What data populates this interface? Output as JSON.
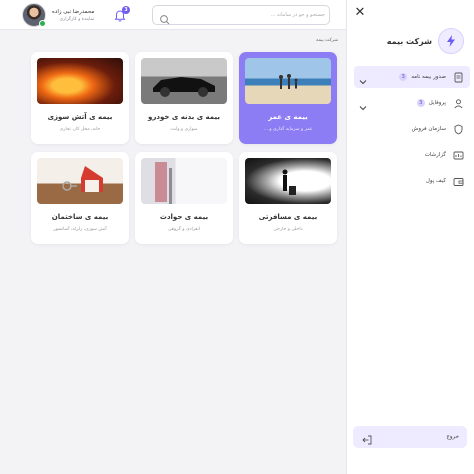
{
  "user": {
    "name": "محمدرضا نبی زاده",
    "role": "نماینده و کارگزاری"
  },
  "notifications": {
    "count": "3"
  },
  "search": {
    "placeholder": "جستجو و جو در سامانه ..."
  },
  "sidebar": {
    "company": "شرکت بیمه",
    "items": [
      {
        "label": "صدور بیمه نامه",
        "badge": "3",
        "icon": "policy-issue-icon",
        "expandable": true,
        "active": true
      },
      {
        "label": "پروفایل",
        "badge": "3",
        "icon": "user-icon",
        "expandable": true,
        "active": false
      },
      {
        "label": "سازمان فروش",
        "badge": "",
        "icon": "shield-icon",
        "expandable": false,
        "active": false
      },
      {
        "label": "گزارشات",
        "badge": "",
        "icon": "report-icon",
        "expandable": false,
        "active": false
      },
      {
        "label": "کیف پول",
        "badge": "",
        "icon": "wallet-icon",
        "expandable": false,
        "active": false
      }
    ],
    "logout_label": "خروج"
  },
  "main": {
    "section_title": "شرکت بیمه",
    "cards": [
      {
        "title": "بیمه ی عمر",
        "subtitle": "عمر و سرمایه گذاری و ...",
        "image": "life-image",
        "active": true
      },
      {
        "title": "بیمه ی بدنه ی خودرو",
        "subtitle": "سواری و وانت",
        "image": "car-image",
        "active": false
      },
      {
        "title": "بیمه ی آتش سوزی",
        "subtitle": "خانه، محل کار، تجاری",
        "image": "fire-image",
        "active": false
      },
      {
        "title": "بیمه ی مسافرتی",
        "subtitle": "داخلی و خارجی",
        "image": "travel-image",
        "active": false
      },
      {
        "title": "بیمه ی حوادث",
        "subtitle": "انفرادی و گروهی",
        "image": "accident-image",
        "active": false
      },
      {
        "title": "بیمه ی ساختمان",
        "subtitle": "آتش سوزی، زلزله، آسانسور",
        "image": "building-image",
        "active": false
      }
    ]
  },
  "colors": {
    "accent": "#8c7df4",
    "accent_light": "#eeeaff",
    "online": "#29b34a",
    "background": "#f3f3f6"
  }
}
